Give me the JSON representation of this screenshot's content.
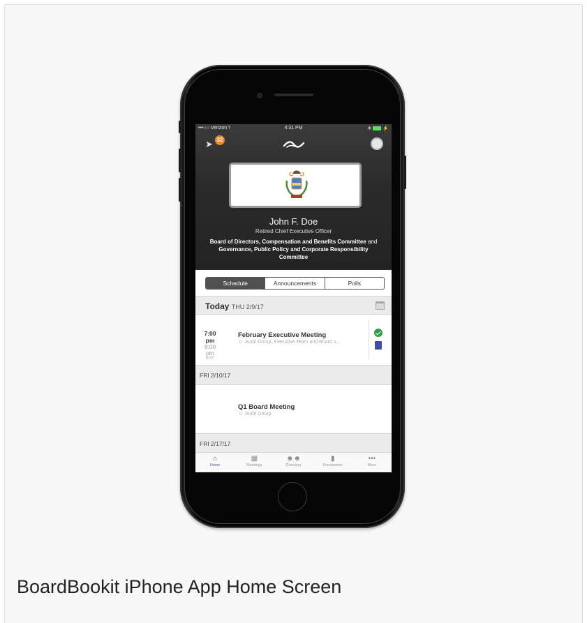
{
  "caption": "BoardBookit iPhone App Home Screen",
  "status_bar": {
    "carrier": "•••○○ Verizon",
    "time": "4:31 PM"
  },
  "header": {
    "notification_count": "32",
    "profile": {
      "name": "John F. Doe",
      "role": "Retired Chief Executive Officer",
      "committees_part1": "Board of Directors, Compensation and Benefits Committee",
      "committees_and": " and ",
      "committees_part2": "Governance, Public Policy and Corporate Responsibility Committee"
    }
  },
  "segments": [
    {
      "label": "Schedule",
      "active": true
    },
    {
      "label": "Announcements",
      "active": false
    },
    {
      "label": "Polls",
      "active": false
    }
  ],
  "schedule": {
    "today_label": "Today",
    "today_date": "THU 2/9/17",
    "meetings": [
      {
        "start": "7:00 pm",
        "end": "8:00 pm",
        "tz": "EST",
        "title": "February Executive Meeting",
        "groups": "Audit Group, Executive Team and Board o..."
      },
      {
        "date_header": "FRI 2/10/17",
        "title": "Q1 Board Meeting",
        "groups": "Audit Group"
      }
    ],
    "next_date": "FRI 2/17/17"
  },
  "tabbar": [
    {
      "label": "Home",
      "icon": "home-icon",
      "active": true
    },
    {
      "label": "Meetings",
      "icon": "calendar-icon",
      "active": false
    },
    {
      "label": "Directory",
      "icon": "people-icon",
      "active": false
    },
    {
      "label": "Documents",
      "icon": "document-icon",
      "active": false
    },
    {
      "label": "More",
      "icon": "more-icon",
      "active": false
    }
  ],
  "colors": {
    "accent": "#5848a8",
    "badge": "#e8892c",
    "rsvp_ok": "#2e9d46",
    "book": "#3f4ea8"
  }
}
